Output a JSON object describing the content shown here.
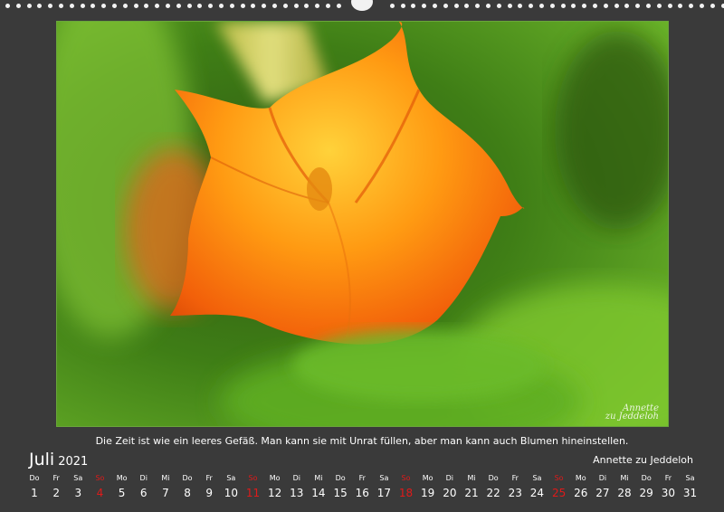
{
  "quote": "Die Zeit ist wie ein leeres Gefäß. Man kann sie mit Unrat füllen, aber man kann auch Blumen hineinstellen.",
  "month": "Juli",
  "year": "2021",
  "author": "Annette zu Jeddeloh",
  "signature_lines": [
    "Annette",
    "zu Jeddeloh"
  ],
  "colors": {
    "background": "#3a3a3a",
    "sunday": "#e01a1a",
    "text": "#ffffff"
  },
  "days": [
    {
      "wd": "Do",
      "n": "1"
    },
    {
      "wd": "Fr",
      "n": "2"
    },
    {
      "wd": "Sa",
      "n": "3"
    },
    {
      "wd": "So",
      "n": "4",
      "sun": true
    },
    {
      "wd": "Mo",
      "n": "5"
    },
    {
      "wd": "Di",
      "n": "6"
    },
    {
      "wd": "Mi",
      "n": "7"
    },
    {
      "wd": "Do",
      "n": "8"
    },
    {
      "wd": "Fr",
      "n": "9"
    },
    {
      "wd": "Sa",
      "n": "10"
    },
    {
      "wd": "So",
      "n": "11",
      "sun": true
    },
    {
      "wd": "Mo",
      "n": "12"
    },
    {
      "wd": "Di",
      "n": "13"
    },
    {
      "wd": "Mi",
      "n": "14"
    },
    {
      "wd": "Do",
      "n": "15"
    },
    {
      "wd": "Fr",
      "n": "16"
    },
    {
      "wd": "Sa",
      "n": "17"
    },
    {
      "wd": "So",
      "n": "18",
      "sun": true
    },
    {
      "wd": "Mo",
      "n": "19"
    },
    {
      "wd": "Di",
      "n": "20"
    },
    {
      "wd": "Mi",
      "n": "21"
    },
    {
      "wd": "Do",
      "n": "22"
    },
    {
      "wd": "Fr",
      "n": "23"
    },
    {
      "wd": "Sa",
      "n": "24"
    },
    {
      "wd": "So",
      "n": "25",
      "sun": true
    },
    {
      "wd": "Mo",
      "n": "26"
    },
    {
      "wd": "Di",
      "n": "27"
    },
    {
      "wd": "Mi",
      "n": "28"
    },
    {
      "wd": "Do",
      "n": "29"
    },
    {
      "wd": "Fr",
      "n": "30"
    },
    {
      "wd": "Sa",
      "n": "31"
    }
  ]
}
